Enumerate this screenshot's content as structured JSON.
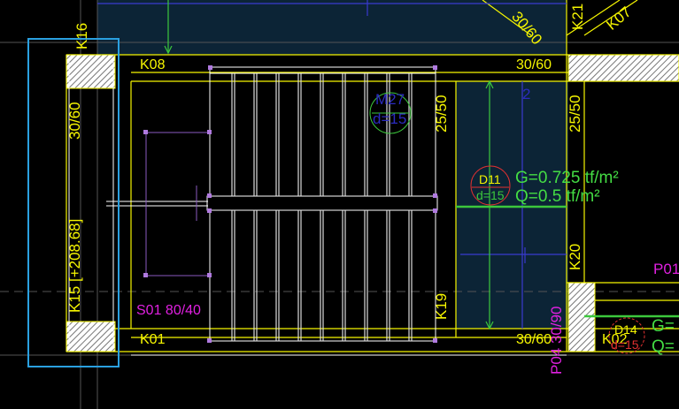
{
  "labels": {
    "k16": "K16",
    "k21": "K21",
    "k07": "K07",
    "b3060_top": "30/60",
    "k08": "K08",
    "b3060_right": "30/60",
    "b3060_left": "30/60",
    "m27": "M27",
    "m27_d": "d=15",
    "b2550_a": "25/50",
    "b2550_b": "25/50",
    "num2": "2",
    "d11": "D11",
    "d11_d": "d=15",
    "load_g1": "G=0.725 tf/m²",
    "load_q1": "Q=0.5 tf/m²",
    "k15": "K15 [+208.68]",
    "k20": "K20",
    "p01": "P01",
    "s01": "S01 80/40",
    "k19": "K19",
    "p04": "P04 30/90",
    "k01": "K01",
    "b3060_bottom": "30/60",
    "k02": "K02",
    "d14": "D14",
    "d14_d": "d=15",
    "load_g2": "G=",
    "load_q2": "Q="
  },
  "colors": {
    "background": "#000000",
    "beam": "#f5f500",
    "load_text": "#44dd44",
    "section_text": "#e020e0",
    "slab_fill": "#0c2436",
    "selection": "#2aa0e0"
  }
}
